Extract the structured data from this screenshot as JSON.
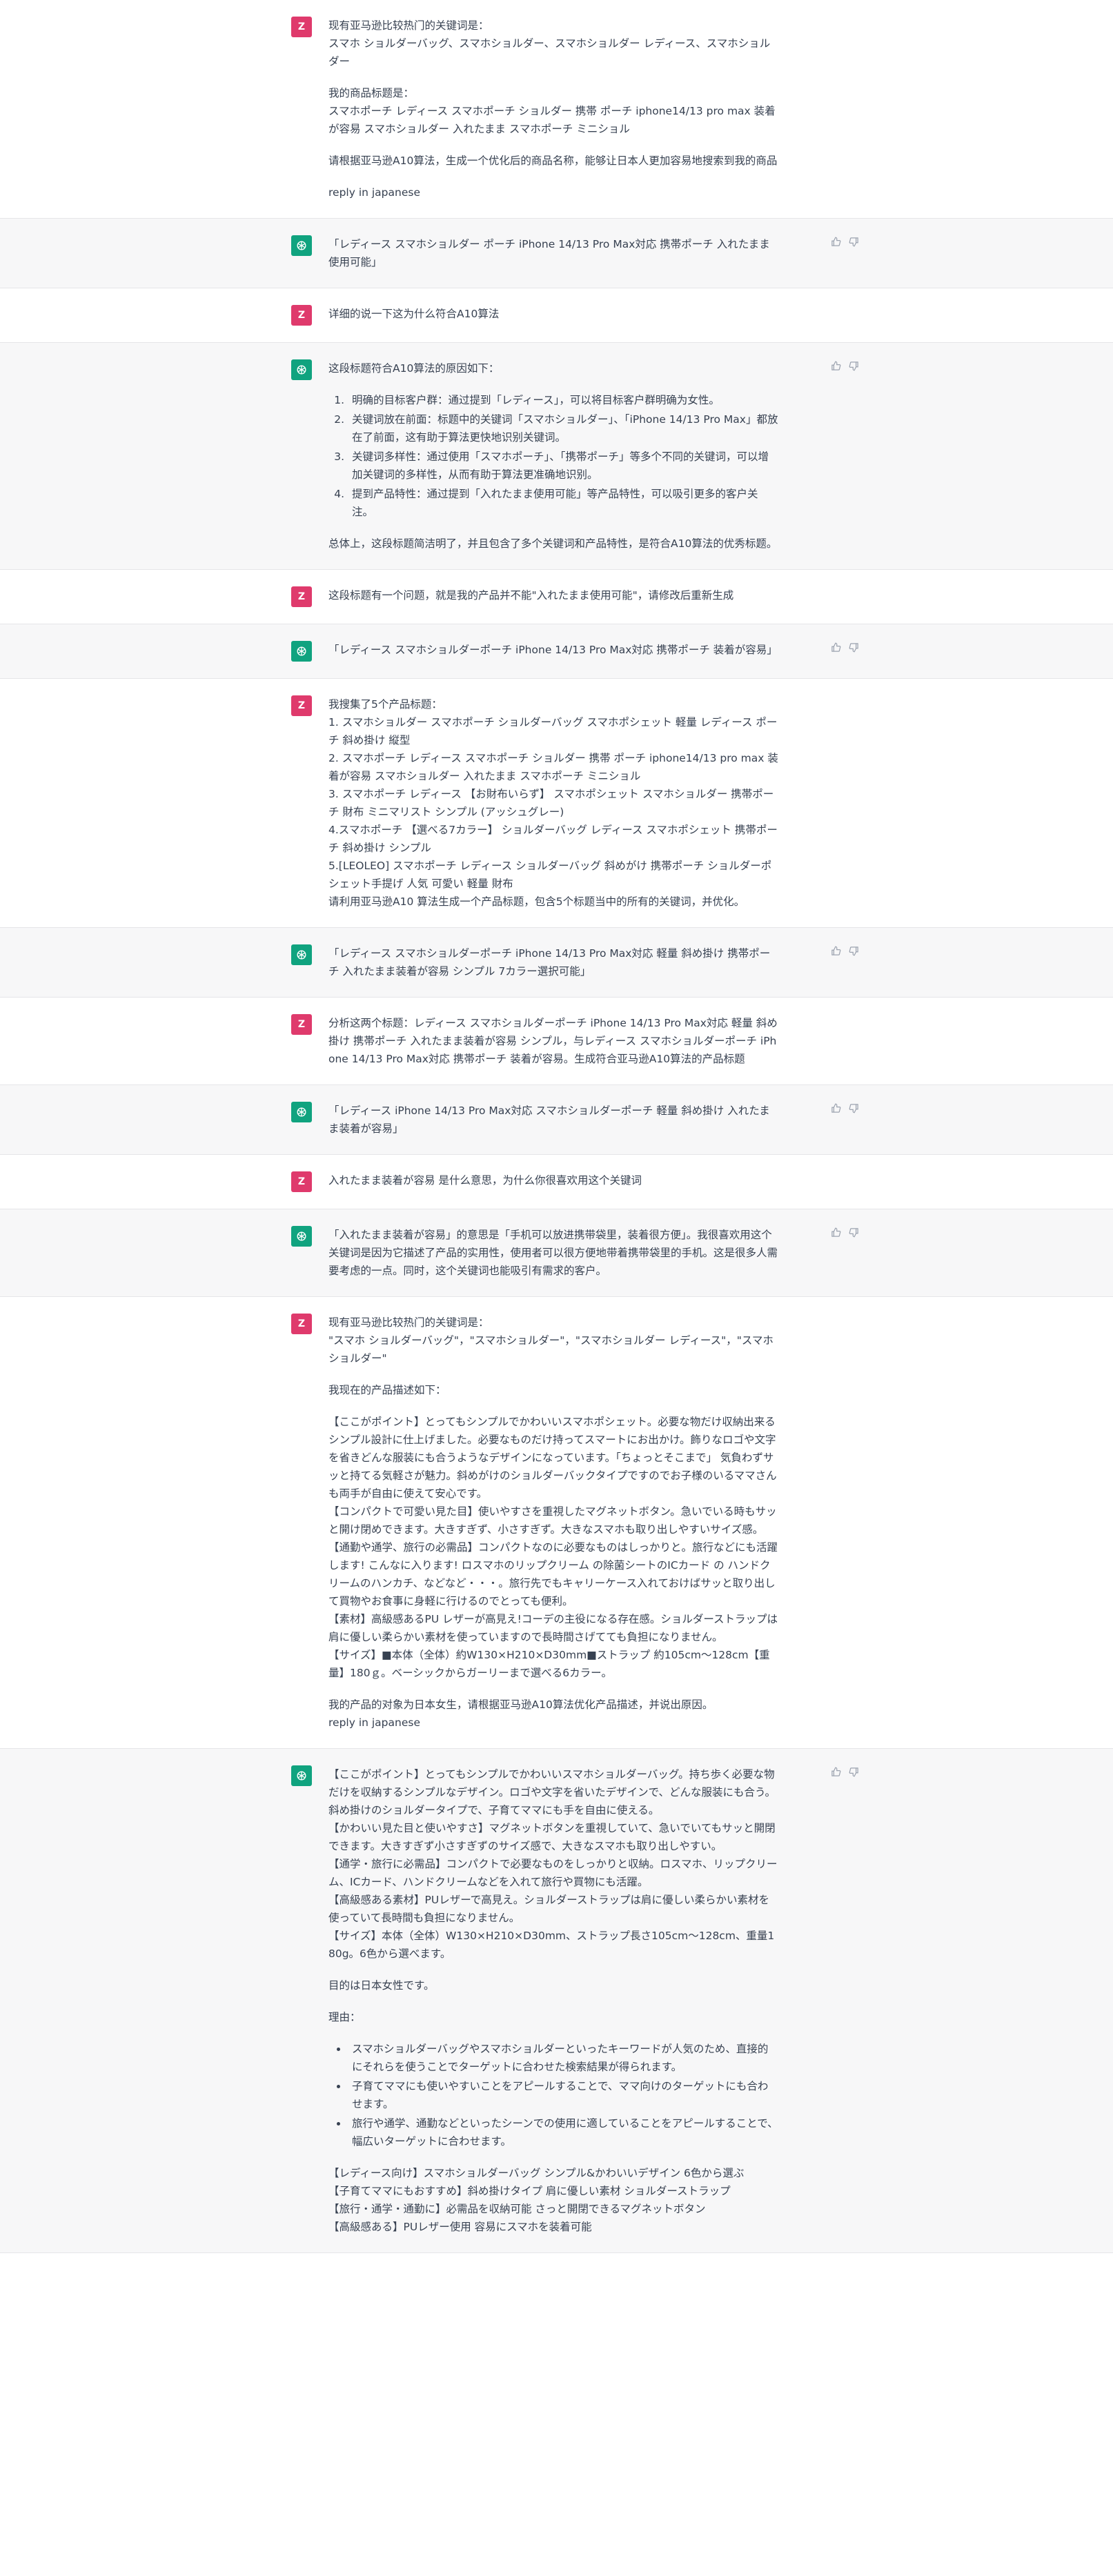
{
  "user_avatar": "Z",
  "messages": [
    {
      "role": "user",
      "paragraphs": [
        "现有亚马逊比较热门的关键词是：\nスマホ ショルダーバッグ、スマホショルダー、スマホショルダー レディース、スマホショルダー",
        "我的商品标题是：\nスマホポーチ レディース スマホポーチ ショルダー 携帯 ポーチ iphone14/13 pro max 装着が容易 スマホショルダー 入れたまま スマホポーチ ミニショル",
        "请根据亚马逊A10算法，生成一个优化后的商品名称，能够让日本人更加容易地搜索到我的商品",
        "reply in japanese"
      ]
    },
    {
      "role": "bot",
      "paragraphs": [
        "「レディース スマホショルダー ポーチ iPhone 14/13 Pro Max対応 携帯ポーチ 入れたまま使用可能」"
      ]
    },
    {
      "role": "user",
      "paragraphs": [
        "详细的说一下这为什么符合A10算法"
      ]
    },
    {
      "role": "bot",
      "paragraphs": [
        "这段标题符合A10算法的原因如下："
      ],
      "list_type": "ol",
      "list": [
        "明确的目标客户群：通过提到「レディース」，可以将目标客户群明确为女性。",
        "关键词放在前面：标题中的关键词「スマホショルダー」、「iPhone 14/13 Pro Max」都放在了前面，这有助于算法更快地识别关键词。",
        "关键词多样性：通过使用「スマホポーチ」、「携帯ポーチ」等多个不同的关键词，可以增加关键词的多样性，从而有助于算法更准确地识别。",
        "提到产品特性：通过提到「入れたまま使用可能」等产品特性，可以吸引更多的客户关注。"
      ],
      "after": [
        "总体上，这段标题简洁明了，并且包含了多个关键词和产品特性，是符合A10算法的优秀标题。"
      ]
    },
    {
      "role": "user",
      "paragraphs": [
        "这段标题有一个问题，就是我的产品并不能\"入れたまま使用可能\"，请修改后重新生成"
      ]
    },
    {
      "role": "bot",
      "paragraphs": [
        "「レディース スマホショルダーポーチ iPhone 14/13 Pro Max対応 携帯ポーチ 装着が容易」"
      ]
    },
    {
      "role": "user",
      "tight": true,
      "paragraphs": [
        "我搜集了5个产品标题：",
        "1. スマホショルダー スマホポーチ ショルダーバッグ スマホポシェット 軽量 レディース ポーチ 斜め掛け 縦型",
        "2. スマホポーチ レディース スマホポーチ ショルダー 携帯 ポーチ iphone14/13 pro max 装着が容易 スマホショルダー 入れたまま スマホポーチ ミニショル",
        "3. スマホポーチ レディース 【お財布いらず】 スマホポシェット スマホショルダー 携帯ポーチ 財布 ミニマリスト シンプル (アッシュグレー)",
        "4.スマホポーチ 【選べる7カラー】 ショルダーバッグ レディース スマホポシェット 携帯ポーチ 斜め掛け シンプル",
        "5.[LEOLEO] スマホポーチ レディース ショルダーバッグ 斜めがけ 携帯ポーチ ショルダーポシェット手提げ 人気 可愛い 軽量 財布",
        "请利用亚马逊A10 算法生成一个产品标题，包含5个标题当中的所有的关键词，并优化。"
      ]
    },
    {
      "role": "bot",
      "paragraphs": [
        "「レディース スマホショルダーポーチ iPhone 14/13 Pro Max対応 軽量 斜め掛け 携帯ポーチ 入れたまま装着が容易 シンプル 7カラー選択可能」"
      ]
    },
    {
      "role": "user",
      "paragraphs": [
        "分析这两个标题：レディース スマホショルダーポーチ iPhone 14/13 Pro Max対応 軽量 斜め掛け 携帯ポーチ 入れたまま装着が容易 シンプル，与レディース スマホショルダーポーチ iPhone 14/13 Pro Max対応 携帯ポーチ 装着が容易。生成符合亚马逊A10算法的产品标题"
      ]
    },
    {
      "role": "bot",
      "paragraphs": [
        "「レディース iPhone 14/13 Pro Max対応 スマホショルダーポーチ 軽量 斜め掛け 入れたまま装着が容易」"
      ]
    },
    {
      "role": "user",
      "paragraphs": [
        "入れたまま装着が容易 是什么意思，为什么你很喜欢用这个关键词"
      ]
    },
    {
      "role": "bot",
      "paragraphs": [
        "「入れたまま装着が容易」的意思是「手机可以放进携带袋里，装着很方便」。我很喜欢用这个关键词是因为它描述了产品的实用性，使用者可以很方便地带着携带袋里的手机。这是很多人需要考虑的一点。同时，这个关键词也能吸引有需求的客户。"
      ]
    },
    {
      "role": "user",
      "paragraphs": [
        "现有亚马逊比较热门的关键词是：\n\"スマホ ショルダーバッグ\"，\"スマホショルダー\"，\"スマホショルダー レディース\"，\"スマホショルダー\"",
        "我现在的产品描述如下：",
        "【ここがポイント】とってもシンプルでかわいいスマホポシェット。必要な物だけ収納出来るシンプル設計に仕上げました。必要なものだけ持ってスマートにお出かけ。飾りなロゴや文字を省きどんな服装にも合うようなデザインになっています。「ちょっとそこまで」 気負わずサッと持てる気軽さが魅力。斜めがけのショルダーバックタイプですのでお子様のいるママさんも両手が自由に使えて安心です。\n【コンパクトで可愛い見た目】使いやすさを重視したマグネットボタン。急いでいる時もサッと開け閉めできます。大きすぎず、小さすぎず。大きなスマホも取り出しやすいサイズ感。\n【通勤や通学、旅行の必需品】コンパクトなのに必要なものはしっかりと。旅行などにも活躍します! こんなに入ります! ロスマホのリップクリーム の除菌シートのICカード の ハンドクリームのハンカチ、などなど・・・。旅行先でもキャリーケース入れておけばサッと取り出して買物やお食事に身軽に行けるのでとっても便利。\n【素材】高級感あるPU レザーが高見え!コーデの主役になる存在感。ショルダーストラップは肩に優しい柔らかい素材を使っていますので長時間さげてても負担になりません。\n【サイズ】■本体（全体）約W130×H210×D30mm■ストラップ 約105cm～128cm【重量】180ｇ。ベーシックからガーリーまで選べる6カラー。",
        "我的产品的对象为日本女生，请根据亚马逊A10算法优化产品描述，并说出原因。\nreply in japanese"
      ]
    },
    {
      "role": "bot",
      "paragraphs": [
        "【ここがポイント】とってもシンプルでかわいいスマホショルダーバッグ。持ち歩く必要な物だけを収納するシンプルなデザイン。ロゴや文字を省いたデザインで、どんな服装にも合う。斜め掛けのショルダータイプで、子育てママにも手を自由に使える。\n【かわいい見た目と使いやすさ】マグネットボタンを重視していて、急いでいてもサッと開閉できます。大きすぎず小さすぎずのサイズ感で、大きなスマホも取り出しやすい。\n【通学・旅行に必需品】コンパクトで必要なものをしっかりと収納。ロスマホ、リップクリーム、ICカード、ハンドクリームなどを入れて旅行や買物にも活躍。\n【高級感ある素材】PUレザーで高見え。ショルダーストラップは肩に優しい柔らかい素材を使っていて長時間も負担になりません。\n【サイズ】本体（全体）W130×H210×D30mm、ストラップ長さ105cm～128cm、重量180g。6色から選べます。",
        "目的は日本女性です。",
        "理由："
      ],
      "list_type": "ul",
      "list": [
        "スマホショルダーバッグやスマホショルダーといったキーワードが人気のため、直接的にそれらを使うことでターゲットに合わせた検索結果が得られます。",
        "子育てママにも使いやすいことをアピールすることで、ママ向けのターゲットにも合わせます。",
        "旅行や通学、通勤などといったシーンでの使用に適していることをアピールすることで、幅広いターゲットに合わせます。"
      ],
      "after": [
        "【レディース向け】スマホショルダーバッグ シンプル&かわいいデザイン 6色から選ぶ\n【子育てママにもおすすめ】斜め掛けタイプ 肩に優しい素材 ショルダーストラップ\n【旅行・通学・通勤に】必需品を収納可能 さっと開閉できるマグネットボタン\n【高級感ある】PUレザー使用 容易にスマホを装着可能"
      ]
    }
  ]
}
